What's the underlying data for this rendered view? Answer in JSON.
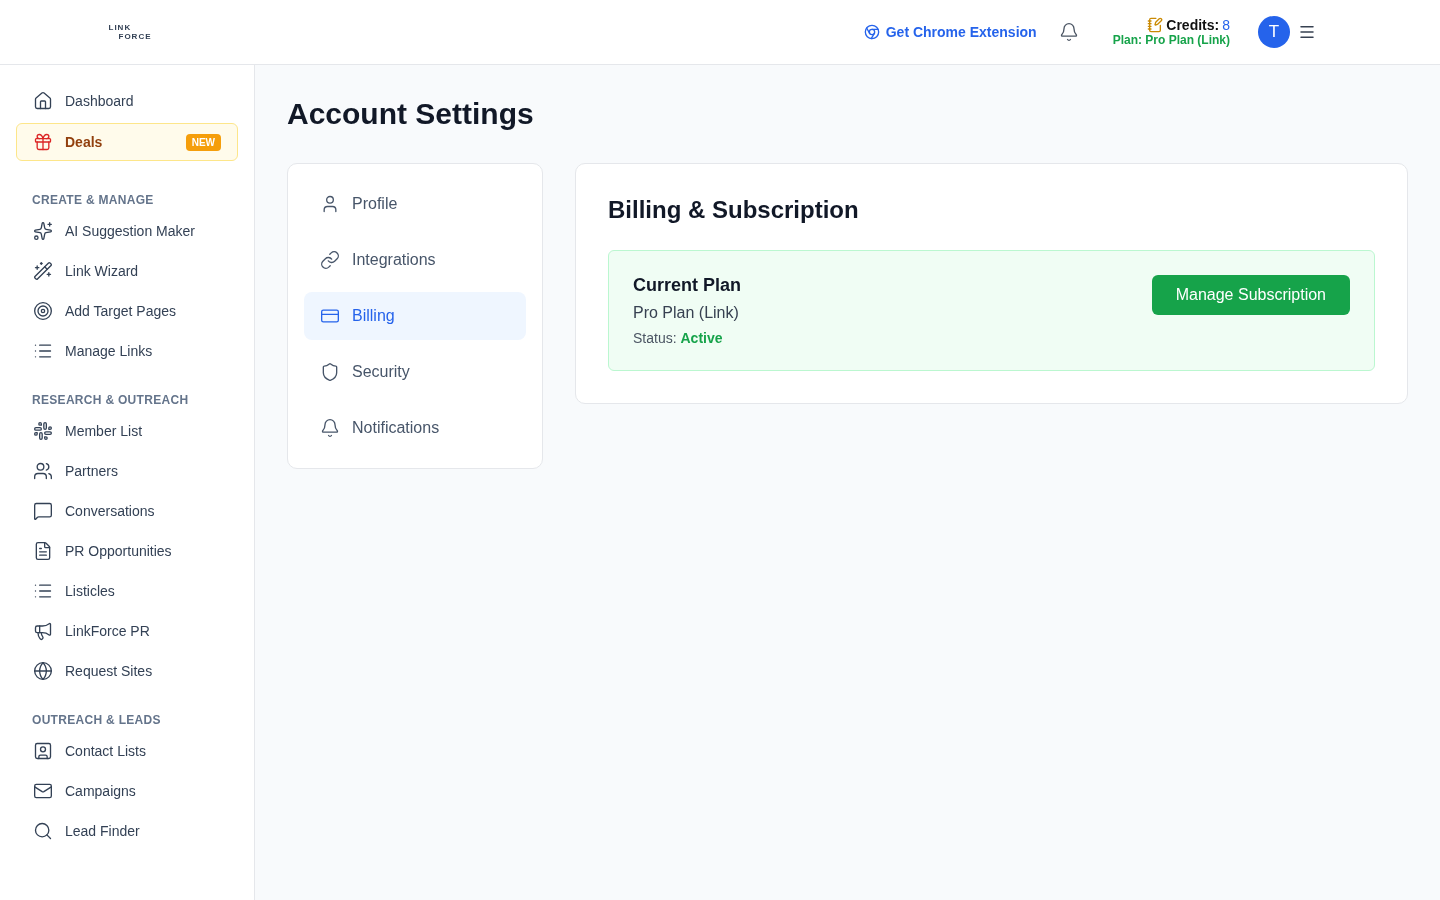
{
  "logo": {
    "line_1": "LINK",
    "line_2": "FORCE"
  },
  "header": {
    "extension_link": "Get Chrome Extension",
    "credits_label": "Credits:",
    "credits_value": "8",
    "plan": "Plan: Pro Plan (Link)",
    "avatar": "T"
  },
  "sidebar": {
    "top_items": [
      {
        "label": "Dashboard",
        "selected": false
      },
      {
        "label": "Deals",
        "selected": true,
        "badge": "NEW"
      }
    ],
    "sections": [
      {
        "title": "CREATE & MANAGE",
        "items": [
          {
            "label": "AI Suggestion Maker"
          },
          {
            "label": "Link Wizard"
          },
          {
            "label": "Add Target Pages"
          },
          {
            "label": "Manage Links"
          }
        ]
      },
      {
        "title": "RESEARCH & OUTREACH",
        "items": [
          {
            "label": "Member List"
          },
          {
            "label": "Partners"
          },
          {
            "label": "Conversations"
          },
          {
            "label": "PR Opportunities"
          },
          {
            "label": "Listicles"
          },
          {
            "label": "LinkForce PR"
          },
          {
            "label": "Request Sites"
          }
        ]
      },
      {
        "title": "OUTREACH & LEADS",
        "items": [
          {
            "label": "Contact Lists"
          },
          {
            "label": "Campaigns"
          },
          {
            "label": "Lead Finder"
          }
        ]
      }
    ]
  },
  "page_title": "Account Settings",
  "settings_nav": [
    {
      "label": "Profile",
      "selected": false
    },
    {
      "label": "Integrations",
      "selected": false
    },
    {
      "label": "Billing",
      "selected": true
    },
    {
      "label": "Security",
      "selected": false
    },
    {
      "label": "Notifications",
      "selected": false
    }
  ],
  "billing": {
    "title": "Billing & Subscription",
    "plan_heading": "Current Plan",
    "plan_name": "Pro Plan (Link)",
    "status_label": "Status:",
    "status_value": "Active",
    "button": "Manage Subscription"
  }
}
